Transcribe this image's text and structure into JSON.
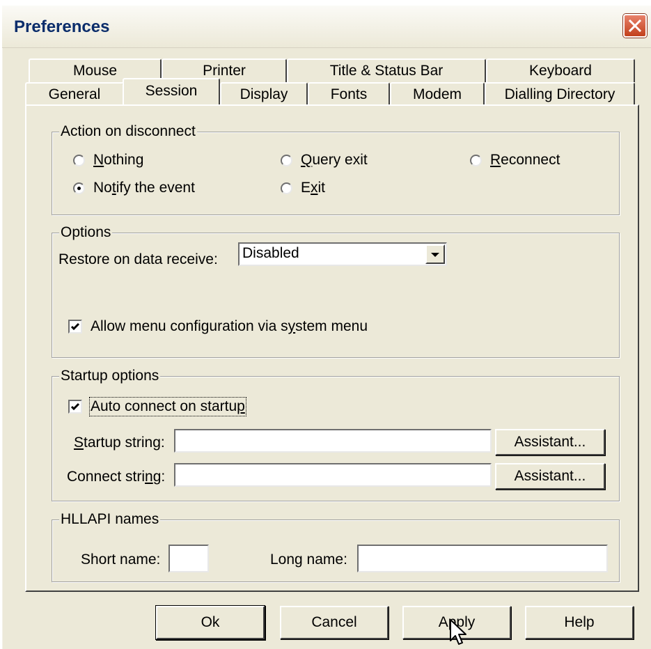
{
  "window": {
    "title": "Preferences"
  },
  "tabs": {
    "back_row": [
      "Mouse",
      "Printer",
      "Title & Status Bar",
      "Keyboard"
    ],
    "front_row": [
      "General",
      "Session",
      "Display",
      "Fonts",
      "Modem",
      "Dialling Directory"
    ],
    "active": "Session"
  },
  "action_on_disconnect": {
    "label": "Action on disconnect",
    "options": [
      {
        "label": "Nothing",
        "accel": "N",
        "rest": "othing",
        "checked": false
      },
      {
        "label": "Notify the event",
        "checked": true
      },
      {
        "label": "Query exit",
        "accel": "Q",
        "rest": "uery exit",
        "checked": false
      },
      {
        "label": "Exit",
        "pre": "E",
        "accel": "x",
        "rest": "it",
        "checked": false
      },
      {
        "label": "Reconnect",
        "accel": "R",
        "rest": "econnect",
        "checked": false
      }
    ]
  },
  "options": {
    "label": "Options",
    "restore_label": "Restore on data receive:",
    "restore_value": "Disabled",
    "allow_menu_pre": "Allow menu configuration via s",
    "allow_menu_accel": "y",
    "allow_menu_rest": "stem menu",
    "allow_menu_checked": true
  },
  "startup": {
    "label": "Startup options",
    "auto_connect_pre": "Auto connect on startu",
    "auto_connect_accel": "p",
    "auto_connect_checked": true,
    "startup_accel": "S",
    "startup_rest": "tartup string:",
    "startup_value": "",
    "connect_pre": "Connect stri",
    "connect_accel": "n",
    "connect_rest": "g:",
    "connect_value": "",
    "assistant_label": "Assistant..."
  },
  "hllapi": {
    "label": "HLLAPI names",
    "short_label": "Short name:",
    "short_value": "",
    "long_label": "Long name:",
    "long_value": ""
  },
  "buttons": {
    "ok": "Ok",
    "cancel": "Cancel",
    "apply": "Apply",
    "help": "Help"
  }
}
